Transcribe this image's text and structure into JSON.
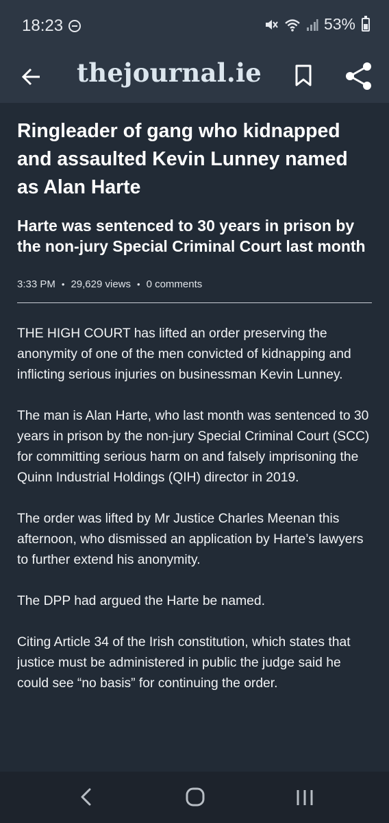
{
  "status_bar": {
    "time": "18:23",
    "battery": "53%"
  },
  "app_bar": {
    "logo_text": "thejournal.ie"
  },
  "article": {
    "headline": "Ringleader of gang who kidnapped and assaulted Kevin Lunney named as Alan Harte",
    "subheadline": "Harte was sentenced to 30 years in prison by the non-jury Special Criminal Court last month",
    "meta": {
      "time": "3:33 PM",
      "views": "29,629 views",
      "comments": "0 comments"
    },
    "paragraphs": [
      "THE HIGH COURT has lifted an order preserving the anonymity of one of the men convicted of kidnapping and inflicting serious injuries on businessman Kevin Lunney.",
      "The man is Alan Harte, who last month was sentenced to 30 years in prison by the non-jury Special Criminal Court (SCC) for committing serious harm on and falsely imprisoning the Quinn Industrial Holdings (QIH) director in 2019.",
      "The order was lifted by Mr Justice Charles Meenan this afternoon, who dismissed an application by Harte’s lawyers to further extend his anonymity.",
      "The DPP had argued the Harte be named.",
      "Citing Article 34 of the Irish constitution, which states that justice must be administered in public the judge said he could see “no basis” for continuing the order."
    ]
  },
  "icons": {
    "back": "arrow-left-icon",
    "bookmark": "bookmark-icon",
    "share": "share-icon",
    "nav_back": "chevron-left-icon",
    "nav_home": "home-circle-icon",
    "nav_recents": "recents-icon"
  }
}
